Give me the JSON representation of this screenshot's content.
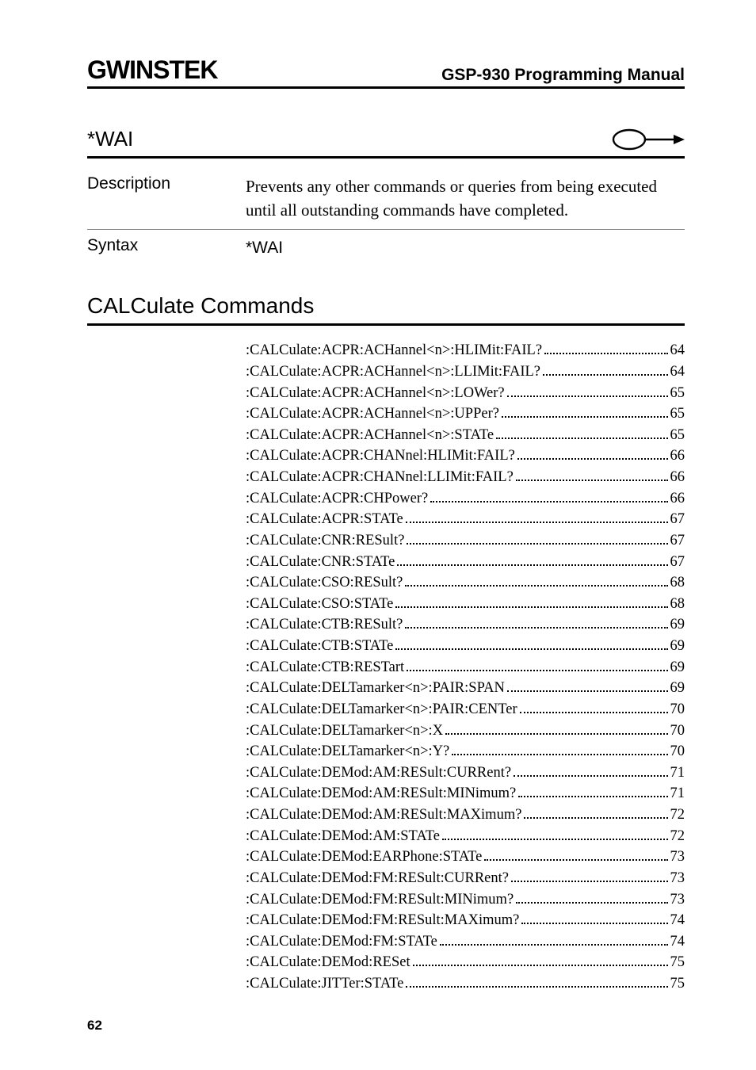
{
  "header": {
    "logo_text": "GWINSTEK",
    "manual_title": "GSP-930 Programming Manual"
  },
  "command": {
    "name": "*WAI",
    "desc_label": "Description",
    "desc_body": "Prevents any other commands or queries from being executed until all outstanding commands have completed.",
    "syntax_label": "Syntax",
    "syntax_body": "*WAI"
  },
  "section_title": "CALCulate Commands",
  "toc": [
    {
      "label": ":CALCulate:ACPR:ACHannel<n>:HLIMit:FAIL?",
      "page": "64"
    },
    {
      "label": ":CALCulate:ACPR:ACHannel<n>:LLIMit:FAIL?",
      "page": "64"
    },
    {
      "label": ":CALCulate:ACPR:ACHannel<n>:LOWer?",
      "page": "65"
    },
    {
      "label": ":CALCulate:ACPR:ACHannel<n>:UPPer?",
      "page": "65"
    },
    {
      "label": ":CALCulate:ACPR:ACHannel<n>:STATe",
      "page": "65"
    },
    {
      "label": ":CALCulate:ACPR:CHANnel:HLIMit:FAIL?",
      "page": "66"
    },
    {
      "label": ":CALCulate:ACPR:CHANnel:LLIMit:FAIL?",
      "page": "66"
    },
    {
      "label": ":CALCulate:ACPR:CHPower?",
      "page": "66"
    },
    {
      "label": ":CALCulate:ACPR:STATe",
      "page": "67"
    },
    {
      "label": ":CALCulate:CNR:RESult?",
      "page": "67"
    },
    {
      "label": ":CALCulate:CNR:STATe",
      "page": "67"
    },
    {
      "label": ":CALCulate:CSO:RESult?",
      "page": "68"
    },
    {
      "label": ":CALCulate:CSO:STATe",
      "page": "68"
    },
    {
      "label": ":CALCulate:CTB:RESult?",
      "page": "69"
    },
    {
      "label": ":CALCulate:CTB:STATe",
      "page": "69"
    },
    {
      "label": ":CALCulate:CTB:RESTart",
      "page": "69"
    },
    {
      "label": ":CALCulate:DELTamarker<n>:PAIR:SPAN",
      "page": "69"
    },
    {
      "label": ":CALCulate:DELTamarker<n>:PAIR:CENTer",
      "page": "70"
    },
    {
      "label": ":CALCulate:DELTamarker<n>:X",
      "page": "70"
    },
    {
      "label": ":CALCulate:DELTamarker<n>:Y?",
      "page": "70"
    },
    {
      "label": ":CALCulate:DEMod:AM:RESult:CURRent?",
      "page": "71"
    },
    {
      "label": ":CALCulate:DEMod:AM:RESult:MINimum?",
      "page": "71"
    },
    {
      "label": ":CALCulate:DEMod:AM:RESult:MAXimum?",
      "page": "72"
    },
    {
      "label": ":CALCulate:DEMod:AM:STATe",
      "page": "72"
    },
    {
      "label": ":CALCulate:DEMod:EARPhone:STATe",
      "page": "73"
    },
    {
      "label": ":CALCulate:DEMod:FM:RESult:CURRent?",
      "page": "73"
    },
    {
      "label": ":CALCulate:DEMod:FM:RESult:MINimum?",
      "page": "73"
    },
    {
      "label": ":CALCulate:DEMod:FM:RESult:MAXimum?",
      "page": "74"
    },
    {
      "label": ":CALCulate:DEMod:FM:STATe",
      "page": "74"
    },
    {
      "label": ":CALCulate:DEMod:RESet",
      "page": "75"
    },
    {
      "label": ":CALCulate:JITTer:STATe",
      "page": "75"
    }
  ],
  "page_number": "62"
}
